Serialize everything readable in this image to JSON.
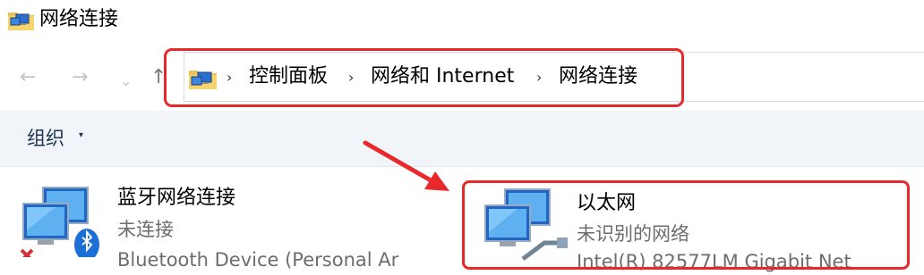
{
  "window": {
    "title": "网络连接",
    "icon": "network-folder-icon"
  },
  "nav": {
    "back_glyph": "←",
    "forward_glyph": "→",
    "recent_glyph": "⌄",
    "up_glyph": "↑"
  },
  "address": {
    "icon": "network-folder-icon",
    "separator": "›",
    "crumbs": [
      "控制面板",
      "网络和 Internet",
      "网络连接"
    ]
  },
  "toolbar": {
    "organize_label": "组织",
    "organize_caret": "▾"
  },
  "connections": [
    {
      "name": "蓝牙网络连接",
      "status": "未连接",
      "device": "Bluetooth Device (Personal Ar",
      "icon": "bluetooth-network-adapter-icon",
      "badge": "disconnected-x-icon"
    },
    {
      "name": "以太网",
      "status": "未识别的网络",
      "device": "Intel(R) 82577LM Gigabit Net",
      "icon": "ethernet-adapter-icon",
      "badge": "cable-icon"
    }
  ],
  "annotation_colors": {
    "highlight": "#e8282b"
  }
}
